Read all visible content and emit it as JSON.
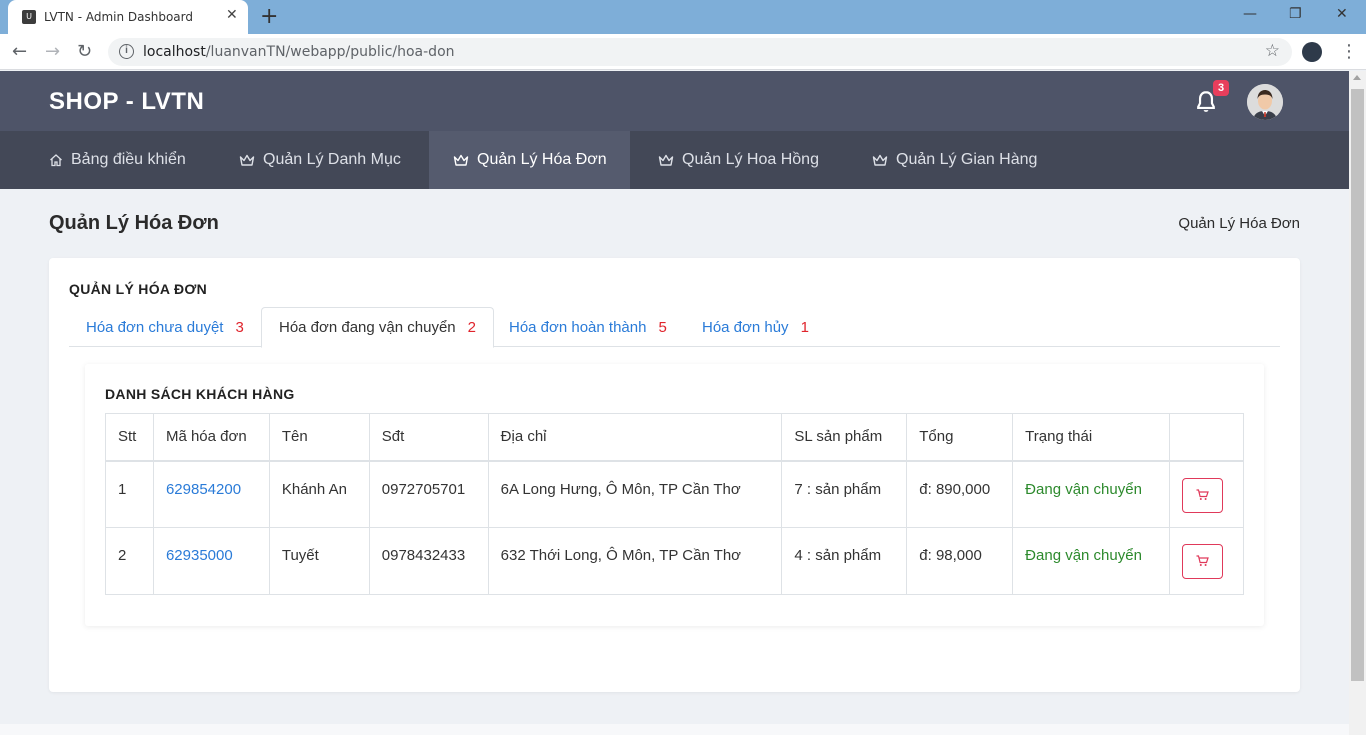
{
  "browser": {
    "tab_title": "LVTN - Admin Dashboard",
    "favicon_letter": "U",
    "url_host": "localhost",
    "url_path": "/luanvanTN/webapp/public/hoa-don"
  },
  "header": {
    "brand": "SHOP - LVTN",
    "notification_count": "3"
  },
  "nav": {
    "items": [
      {
        "label": "Bảng điều khiển",
        "icon": "home-icon"
      },
      {
        "label": "Quản Lý Danh Mục",
        "icon": "crown-icon"
      },
      {
        "label": "Quản Lý Hóa Đơn",
        "icon": "crown-icon",
        "active": true
      },
      {
        "label": "Quản Lý Hoa Hồng",
        "icon": "crown-icon"
      },
      {
        "label": "Quản Lý Gian Hàng",
        "icon": "crown-icon"
      }
    ]
  },
  "page": {
    "title": "Quản Lý Hóa Đơn",
    "breadcrumb": "Quản Lý Hóa Đơn"
  },
  "card": {
    "title": "QUẢN LÝ HÓA ĐƠN",
    "tabs": [
      {
        "label": "Hóa đơn chưa duyệt",
        "count": "3"
      },
      {
        "label": "Hóa đơn đang vận chuyển",
        "count": "2",
        "active": true
      },
      {
        "label": "Hóa đơn hoàn thành",
        "count": "5"
      },
      {
        "label": "Hóa đơn hủy",
        "count": "1"
      }
    ]
  },
  "list": {
    "title": "DANH SÁCH KHÁCH HÀNG",
    "columns": [
      "Stt",
      "Mã hóa đơn",
      "Tên",
      "Sđt",
      "Địa chỉ",
      "SL sản phẩm",
      "Tổng",
      "Trạng thái",
      ""
    ],
    "rows": [
      {
        "stt": "1",
        "ma": "629854200",
        "ten": "Khánh An",
        "sdt": "0972705701",
        "diachi": "6A Long Hưng, Ô Môn, TP Cần Thơ",
        "sl": "7 : sản phẩm",
        "tong": "đ: 890,000",
        "trangthai": "Đang vận chuyển"
      },
      {
        "stt": "2",
        "ma": "62935000",
        "ten": "Tuyết",
        "sdt": "0978432433",
        "diachi": "632 Thới Long, Ô Môn, TP Cần Thơ",
        "sl": "4 : sản phẩm",
        "tong": "đ: 98,000",
        "trangthai": "Đang vận chuyển"
      }
    ]
  },
  "colors": {
    "header_bg": "#4e5468",
    "nav_bg": "#434857",
    "link": "#2a7bd8",
    "count": "#e0242c",
    "status": "#2d8a2d",
    "action_border": "#e0395a"
  }
}
